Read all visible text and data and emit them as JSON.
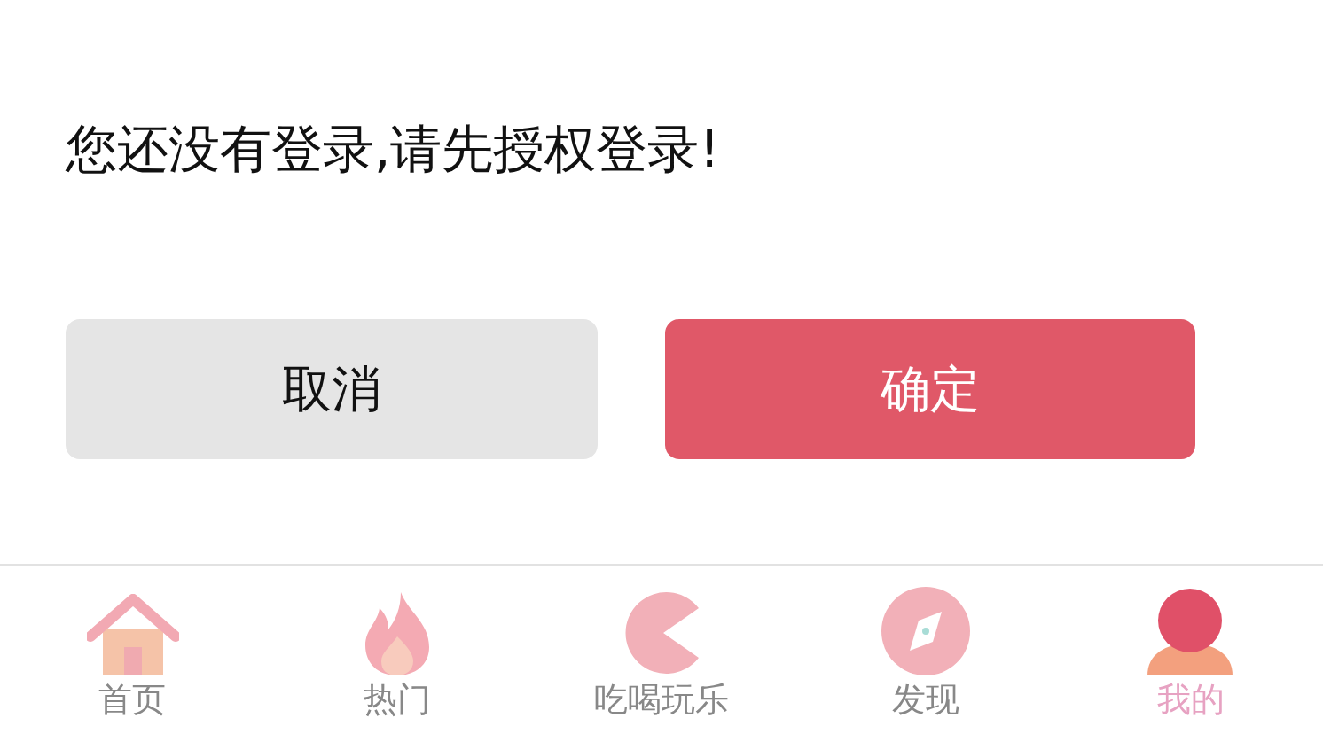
{
  "dialog": {
    "message": "您还没有登录,请先授权登录!",
    "buttons": [
      {
        "label": "取消",
        "kind": "cancel"
      },
      {
        "label": "确定",
        "kind": "confirm"
      }
    ]
  },
  "tab_bar": [
    {
      "label": "首页",
      "kind": "home",
      "selected": false
    },
    {
      "label": "热门",
      "kind": "flame",
      "selected": false
    },
    {
      "label": "吃喝玩乐",
      "kind": "pacman",
      "selected": false
    },
    {
      "label": "发现",
      "kind": "compass",
      "selected": false
    },
    {
      "label": "我的",
      "kind": "person",
      "selected": true
    }
  ]
}
